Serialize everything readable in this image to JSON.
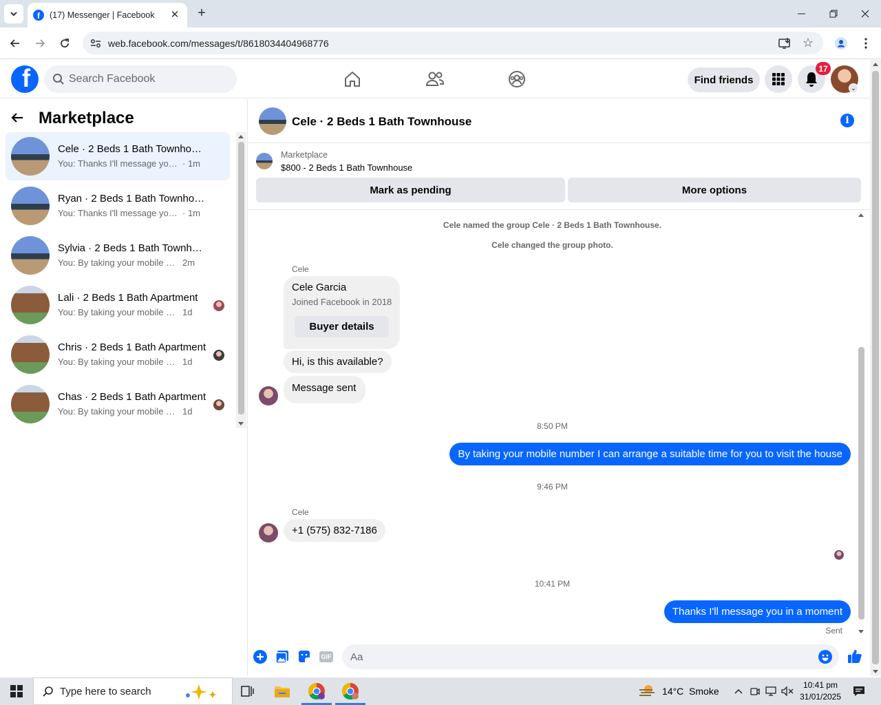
{
  "browser": {
    "tab_title": "(17) Messenger | Facebook",
    "url": "web.facebook.com/messages/t/8618034404968776"
  },
  "fb": {
    "search_placeholder": "Search Facebook",
    "find_friends": "Find friends",
    "notif_count": "17"
  },
  "left": {
    "title": "Marketplace",
    "conversations": [
      {
        "name": "Cele · 2 Beds 1 Bath Townhouse",
        "snippet": "You: Thanks I'll message you in a moment",
        "time": "· 1m",
        "thumb": "townhouse",
        "active": true
      },
      {
        "name": "Ryan · 2 Beds 1 Bath Townhouse",
        "snippet": "You: Thanks I'll message you in a moment",
        "time": "· 1m",
        "thumb": "townhouse"
      },
      {
        "name": "Sylvia · 2 Beds 1 Bath Townhouse",
        "snippet": "You: By taking your mobile number I can arrange",
        "time": "2m",
        "thumb": "townhouse"
      },
      {
        "name": "Lali · 2 Beds 1 Bath Apartment",
        "snippet": "You: By taking your mobile number I can arrange",
        "time": "1d",
        "thumb": "apartment",
        "seen": true
      },
      {
        "name": "Chris · 2 Beds 1 Bath Apartment",
        "snippet": "You: By taking your mobile number I can arrange",
        "time": "1d",
        "thumb": "apartment",
        "seen": true
      },
      {
        "name": "Chas · 2 Beds 1 Bath Apartment",
        "snippet": "You: By taking your mobile number I can arrange",
        "time": "1d",
        "thumb": "apartment",
        "seen": true
      }
    ]
  },
  "chat": {
    "title": "Cele · 2 Beds 1 Bath Townhouse",
    "marketplace_label": "Marketplace",
    "listing": "$800 - 2 Beds 1 Bath Townhouse",
    "mark_pending": "Mark as pending",
    "more_options": "More options",
    "sys_named": "Cele named the group Cele · 2 Beds 1 Bath Townhouse.",
    "sys_photo": "Cele changed the group photo.",
    "sender": "Cele",
    "card_name": "Cele Garcia",
    "card_sub": "Joined Facebook in 2018",
    "buyer_details": "Buyer details",
    "msg1": "Hi, is this available?",
    "msg2": "Message sent",
    "time1": "8:50 PM",
    "out1": "By taking your mobile number I can arrange a suitable time for you to visit the house",
    "time2": "9:46 PM",
    "phone": "+1 (575) 832-7186",
    "time3": "10:41 PM",
    "out2": "Thanks I'll message you in a moment",
    "sent": "Sent",
    "composer_placeholder": "Aa",
    "gif": "GIF"
  },
  "taskbar": {
    "search_placeholder": "Type here to search",
    "weather": "14°C  Smoke",
    "time": "10:41 pm",
    "date": "31/01/2025"
  },
  "colors": {
    "accent": "#0866ff",
    "badge": "#e41e3f",
    "active_row": "#ebf3ff"
  }
}
